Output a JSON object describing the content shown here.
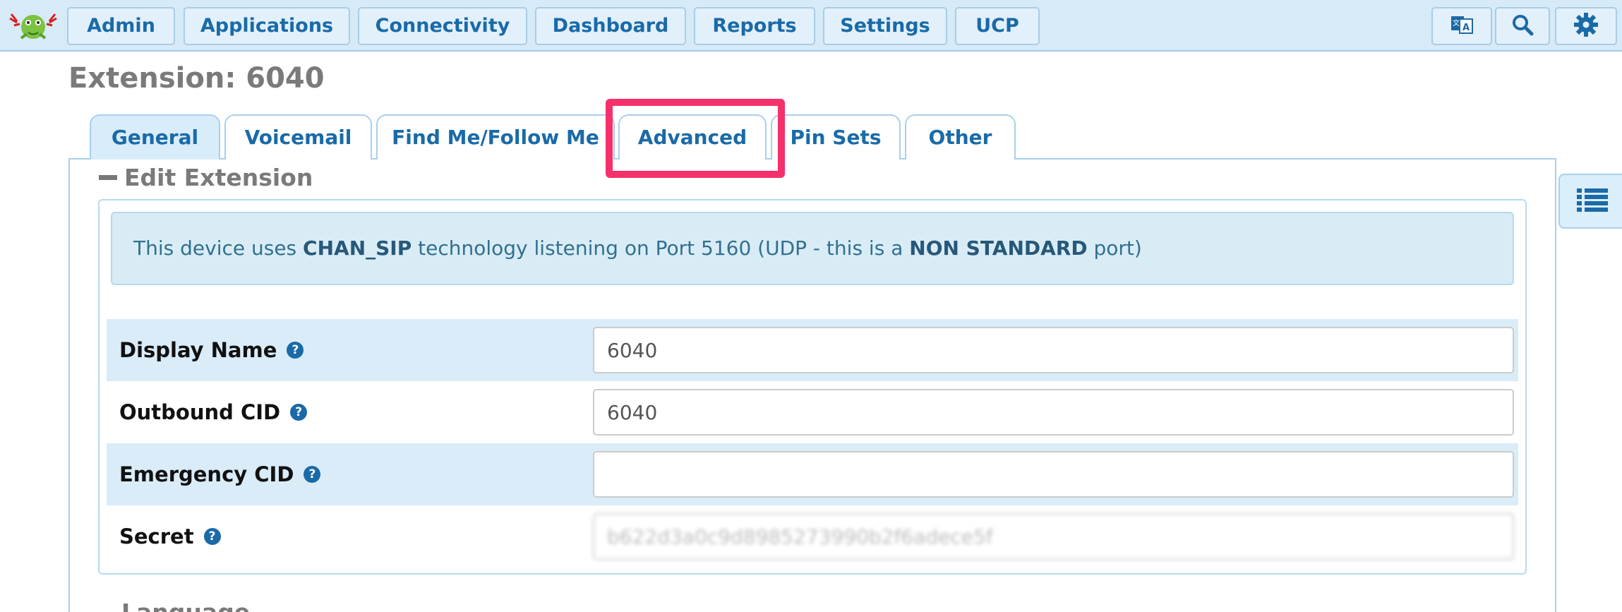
{
  "nav": {
    "items": [
      {
        "label": "Admin"
      },
      {
        "label": "Applications"
      },
      {
        "label": "Connectivity"
      },
      {
        "label": "Dashboard"
      },
      {
        "label": "Reports"
      },
      {
        "label": "Settings"
      },
      {
        "label": "UCP"
      }
    ],
    "icons": [
      "language-icon",
      "search-icon",
      "gear-icon"
    ]
  },
  "page": {
    "title": "Extension: 6040"
  },
  "tabs": [
    {
      "label": "General"
    },
    {
      "label": "Voicemail"
    },
    {
      "label": "Find Me/Follow Me"
    },
    {
      "label": "Advanced"
    },
    {
      "label": "Pin Sets"
    },
    {
      "label": "Other"
    }
  ],
  "section": {
    "title": "Edit Extension",
    "next_title": "Language"
  },
  "alert": {
    "prefix": "This device uses ",
    "tech": "CHAN_SIP",
    "middle": " technology listening on Port 5160 (UDP - this is a ",
    "emphasis": "NON STANDARD",
    "suffix": " port)"
  },
  "form": {
    "display_name": {
      "label": "Display Name",
      "value": "6040"
    },
    "outbound_cid": {
      "label": "Outbound CID",
      "value": "6040"
    },
    "emergency_cid": {
      "label": "Emergency CID",
      "value": ""
    },
    "secret": {
      "label": "Secret",
      "value": "b622d3a0c9d8985273990b2f6adece5f"
    }
  },
  "colors": {
    "accent": "#1a6aa8",
    "navbar": "#d6eaf8",
    "highlight": "#f5306a"
  }
}
